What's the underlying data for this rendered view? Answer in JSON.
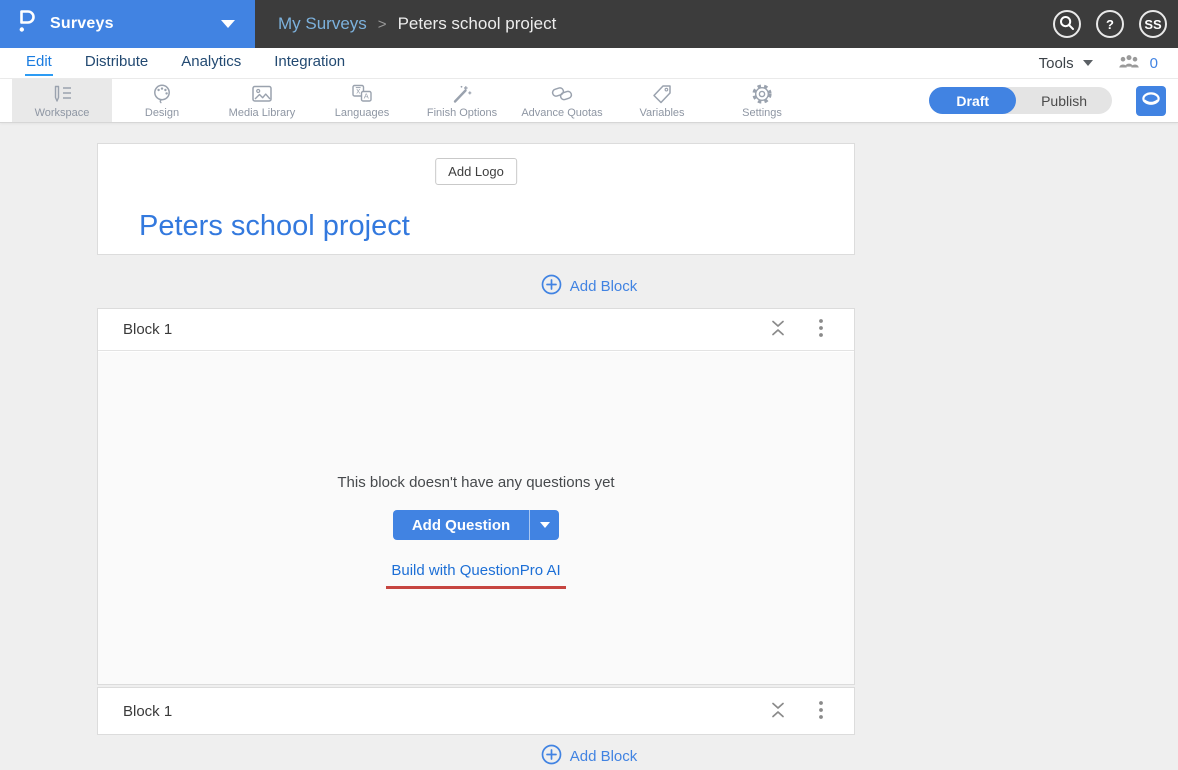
{
  "topbar": {
    "product_label": "Surveys",
    "breadcrumb": {
      "parent": "My Surveys",
      "separator": ">",
      "current": "Peters school project"
    },
    "help_label": "?",
    "avatar_initials": "SS"
  },
  "nav": {
    "tabs": [
      {
        "label": "Edit",
        "active": true
      },
      {
        "label": "Distribute",
        "active": false
      },
      {
        "label": "Analytics",
        "active": false
      },
      {
        "label": "Integration",
        "active": false
      }
    ],
    "tools_label": "Tools",
    "collaborators_count": "0"
  },
  "toolbar": {
    "items": [
      {
        "label": "Workspace",
        "icon": "workspace-icon",
        "active": true
      },
      {
        "label": "Design",
        "icon": "design-icon",
        "active": false
      },
      {
        "label": "Media Library",
        "icon": "media-library-icon",
        "active": false
      },
      {
        "label": "Languages",
        "icon": "languages-icon",
        "active": false
      },
      {
        "label": "Finish Options",
        "icon": "finish-options-icon",
        "active": false
      },
      {
        "label": "Advance Quotas",
        "icon": "advance-quotas-icon",
        "active": false
      },
      {
        "label": "Variables",
        "icon": "variables-icon",
        "active": false
      },
      {
        "label": "Settings",
        "icon": "settings-icon",
        "active": false
      }
    ],
    "draft_label": "Draft",
    "publish_label": "Publish"
  },
  "survey": {
    "add_logo_label": "Add Logo",
    "title": "Peters school project",
    "add_block_top_label": "Add Block",
    "add_block_bottom_label": "Add Block",
    "block": {
      "name": "Block 1",
      "empty_message": "This block doesn't have any questions yet",
      "add_question_label": "Add Question",
      "ai_link_label": "Build with QuestionPro AI"
    },
    "block_footer_name": "Block 1"
  },
  "colors": {
    "accent_blue": "#4183e2",
    "topbar_dark": "#3c3c3c",
    "breadcrumb_link_blue": "#7cb1dc",
    "active_tab_blue": "#1a7ce0",
    "inactive_tab_navy": "#234a72",
    "title_blue": "#3379de",
    "ai_underline_red": "#c64540"
  }
}
